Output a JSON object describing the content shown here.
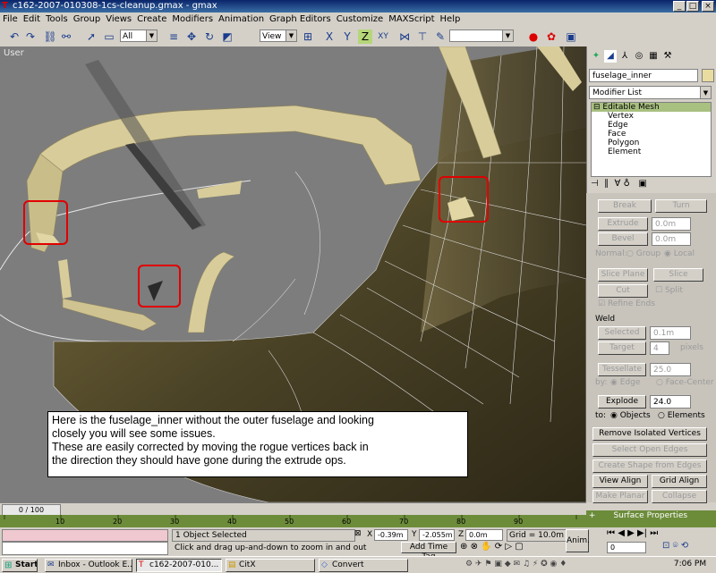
{
  "window": {
    "title": "c162-2007-010308-1cs-cleanup.gmax - gmax"
  },
  "menu": [
    "File",
    "Edit",
    "Tools",
    "Group",
    "Views",
    "Create",
    "Modifiers",
    "Animation",
    "Graph Editors",
    "Customize",
    "MAXScript",
    "Help"
  ],
  "toolbar": {
    "selection_filter": "All",
    "ref_coord": "View",
    "axis_label_xy": "XY",
    "named_selection": ""
  },
  "viewport": {
    "label": "User"
  },
  "note": {
    "line1": "Here is the fuselage_inner without the outer fuselage and looking",
    "line2": "closely you will see some issues.",
    "line3": "These are easily corrected by moving the rogue vertices back in",
    "line4": "the direction they should have gone during the extrude ops."
  },
  "panel": {
    "object_name": "fuselage_inner",
    "modifier_list": "Modifier List",
    "stack": {
      "root": "Editable Mesh",
      "items": [
        "Vertex",
        "Edge",
        "Face",
        "Polygon",
        "Element"
      ]
    },
    "buttons": {
      "break": "Break",
      "turn": "Turn",
      "extrude": "Extrude",
      "extrude_val": "0.0m",
      "bevel": "Bevel",
      "bevel_val": "0.0m",
      "normal": "Normal:",
      "group": "Group",
      "local": "Local",
      "slice_plane": "Slice Plane",
      "slice": "Slice",
      "cut": "Cut",
      "split": "Split",
      "refine": "Refine Ends",
      "weld": "Weld",
      "selected": "Selected",
      "selected_val": "0.1m",
      "target": "Target",
      "target_val": "4",
      "pixels": "pixels",
      "tessellate": "Tessellate",
      "tess_val": "25.0",
      "by": "by:",
      "edge": "Edge",
      "face_center": "Face-Center",
      "explode": "Explode",
      "explode_val": "24.0",
      "to": "to:",
      "objects": "Objects",
      "elements": "Elements",
      "remove_iso": "Remove Isolated Vertices",
      "select_open": "Select Open Edges",
      "create_shape": "Create Shape from Edges",
      "view_align": "View Align",
      "grid_align": "Grid Align",
      "make_planar": "Make Planar",
      "collapse": "Collapse",
      "surface_props": "Surface Properties"
    }
  },
  "timeline": {
    "frame": "0 / 100",
    "ticks": [
      "10",
      "20",
      "30",
      "40",
      "50",
      "60",
      "70",
      "80",
      "90"
    ]
  },
  "status": {
    "selected": "1 Object Selected",
    "prompt": "Click and drag up-and-down to zoom in and out",
    "x_label": "X",
    "x_val": "-0.39m",
    "y_label": "Y",
    "y_val": "-2.055m",
    "z_label": "Z",
    "z_val": "0.0m",
    "grid": "Grid = 10.0m",
    "add_time_tag": "Add Time Tag",
    "anim": "Anim.",
    "frame_field": "0"
  },
  "taskbar": {
    "start": "Start",
    "tasks": [
      "Inbox - Outlook E...",
      "c162-2007-010...",
      "CitX",
      "Convert"
    ],
    "clock": "7:06 PM"
  },
  "colors": {
    "viewport": "#7d7d7d",
    "mesh_tan": "#d8cc9a",
    "mesh_dark": "#4a4226",
    "highlight": "#e00000"
  }
}
